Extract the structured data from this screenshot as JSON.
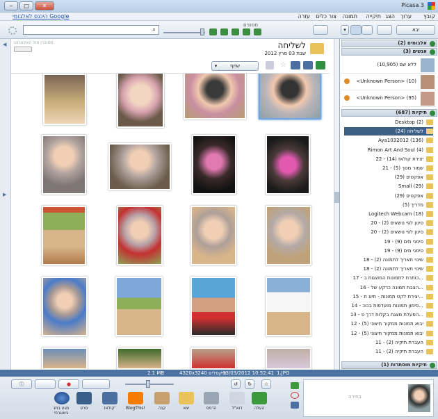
{
  "window": {
    "title": "Picasa 3",
    "help_link": "היכנס לאלבומי Google"
  },
  "menu": [
    "קובץ",
    "ערוך",
    "הצג",
    "תיקייה",
    "תמונה",
    "צור",
    "כלים",
    "עזרה"
  ],
  "toolbar": {
    "import_label": "יבא",
    "filter_label": "מסננים",
    "search_placeholder": ""
  },
  "folder_header": {
    "title": "לשליחה",
    "date": "שבת 03 מרץ 2012",
    "share_label": "שתף",
    "sync_label": "מסנכרן מול האינטרנט"
  },
  "sidebar": {
    "albums_header": "אלבומים (2)",
    "people_header": "אנשים (3)",
    "people": [
      {
        "label": "ללא שם (10,905)"
      },
      {
        "label": "<Unknown Person> (10)"
      },
      {
        "label": "<Unknown Person> (95)"
      }
    ],
    "folders_header": "תיקיות (687)",
    "folders": [
      "Desktop (2)",
      "לשליחה (24)",
      "Aya1032012 (136)",
      "Rimon Art And Soul (4)",
      "22 - יצירת קולאז (14)",
      "21 - שמור מסך (5)",
      "אפקטים (29)",
      "Small (29)",
      "אפקטים (29)",
      "מדריך (5)",
      "Logitech Webcam (18)",
      "20 - סינון לפי נושאים (2)",
      "20 - סינון לפי נושאים (2)",
      "19 - סימני מים (9)",
      "19 - סימני מים (9)",
      "18 - שינוי תאריך לתמונה (2)",
      "18 - שינוי תאריך לתמונה (2)",
      "17 - כותרת לתמונות המוצגות ב...",
      "16 - הצבת תמונה כרקע של...",
      "15 - יצירת לקט תמונות - תיוג ת...",
      "14 - סימון תמונות מועדפות בכוכ...",
      "13 - הפעלת מצגת בקלות דרך פ...",
      "12 - יבוא תמונות ממקור חיצוני (5)",
      "12 - יבוא תמונות ממקור חיצוני (5)",
      "11 - העברת תיקיה (2)",
      "11 - העברת תיקיה (2)"
    ],
    "selected_folder": "לשליחה (24)",
    "hidden_header": "תיקיות מוסתרות (1)"
  },
  "status": {
    "filename": "1.JPG",
    "date": "03/03/2012 10:52:41",
    "dims": "4320x3240 פיקסלים",
    "size": "2.1 MB"
  },
  "bottom": {
    "tray_label": "בחירה",
    "buttons": [
      "העלה",
      "דוא\"ל",
      "הדפס",
      "יצא",
      "קנה",
      "BlogThis!",
      "קולאז'",
      "סרט",
      "מגע בתג גיאוגרפי"
    ]
  },
  "colors": {
    "accent": "#4b72a0",
    "selected": "#3c5f86",
    "folder": "#e9c25a"
  }
}
